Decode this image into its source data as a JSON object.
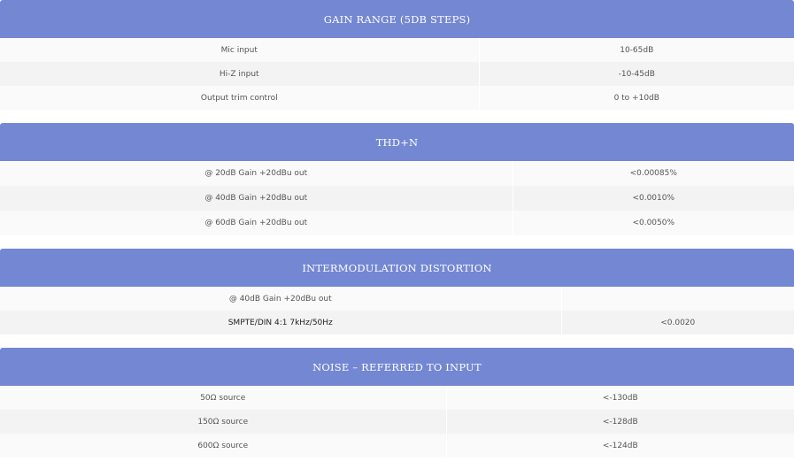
{
  "sections": [
    {
      "title": "Gain Range (5dB Steps)",
      "rows": [
        {
          "label": "Mic input",
          "value": "10-65dB"
        },
        {
          "label": "Hi-Z input",
          "value": "-10-45dB"
        },
        {
          "label": "Output trim control",
          "value": "0 to +10dB"
        }
      ]
    },
    {
      "title": "THD+N",
      "rows": [
        {
          "label": "@ 20dB Gain +20dBu out",
          "value": "<0.00085%"
        },
        {
          "label": "@ 40dB Gain +20dBu out",
          "value": "<0.0010%"
        },
        {
          "label": "@ 60dB Gain +20dBu out",
          "value": "<0.0050%"
        }
      ]
    },
    {
      "title": "Intermodulation Distortion",
      "rows": [
        {
          "label": "@ 40dB Gain +20dBu out",
          "value": ""
        },
        {
          "label": "SMPTE/DIN 4:1 7kHz/50Hz",
          "value": "<0.0020"
        }
      ]
    },
    {
      "title": "Noise – Referred to Input",
      "rows": [
        {
          "label": "50Ω source",
          "value": "<-130dB"
        },
        {
          "label": "150Ω source",
          "value": "<-128dB"
        },
        {
          "label": "600Ω source",
          "value": "<-124dB"
        }
      ]
    }
  ]
}
